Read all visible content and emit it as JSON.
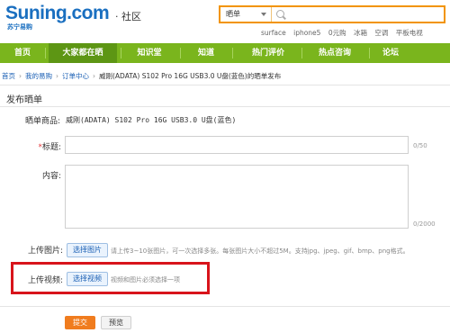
{
  "header": {
    "logo": "Suning.com",
    "logo_sub": "苏宁易购",
    "community": "· 社区",
    "search": {
      "category": "晒单",
      "placeholder": ""
    },
    "hotwords": [
      "surface",
      "iphone5",
      "0元购",
      "冰箱",
      "空调",
      "平板电视"
    ]
  },
  "nav": {
    "items": [
      {
        "label": "首页",
        "active": false
      },
      {
        "label": "大家都在晒",
        "active": true
      },
      {
        "label": "知识堂",
        "active": false
      },
      {
        "label": "知道",
        "active": false
      },
      {
        "label": "热门评价",
        "active": false
      },
      {
        "label": "热点咨询",
        "active": false
      },
      {
        "label": "论坛",
        "active": false
      }
    ]
  },
  "breadcrumb": {
    "items": [
      "首页",
      "我的易购",
      "订单中心"
    ],
    "current": "威刚(ADATA) S102 Pro 16G USB3.0 U盘(蓝色)的晒单发布",
    "separator": "›"
  },
  "form": {
    "section_title": "发布晒单",
    "product_label": "晒单商品:",
    "product_value": "威刚(ADATA) S102 Pro 16G USB3.0 U盘(蓝色)",
    "title_star": "*",
    "title_label": "标题:",
    "title_value": "",
    "title_count": "0/50",
    "content_label": "内容:",
    "content_value": "",
    "content_count": "0/2000",
    "image_label": "上传图片:",
    "image_button": "选择图片",
    "image_hint": "请上传3~10张图片，可一次选择多张。每张图片大小不超过5M。支持jpg、jpeg、gif、bmp、png格式。",
    "video_label": "上传视频:",
    "video_button": "选择视频",
    "video_hint": "视频和图片必须选择一项",
    "submit_button": "提交",
    "preview_button": "预览"
  },
  "colors": {
    "brand_blue": "#1a6fc0",
    "nav_green": "#7ab51d",
    "nav_active": "#5d9614",
    "search_border": "#f29400",
    "highlight_red": "#d8141b",
    "submit_orange": "#f07c1e"
  }
}
